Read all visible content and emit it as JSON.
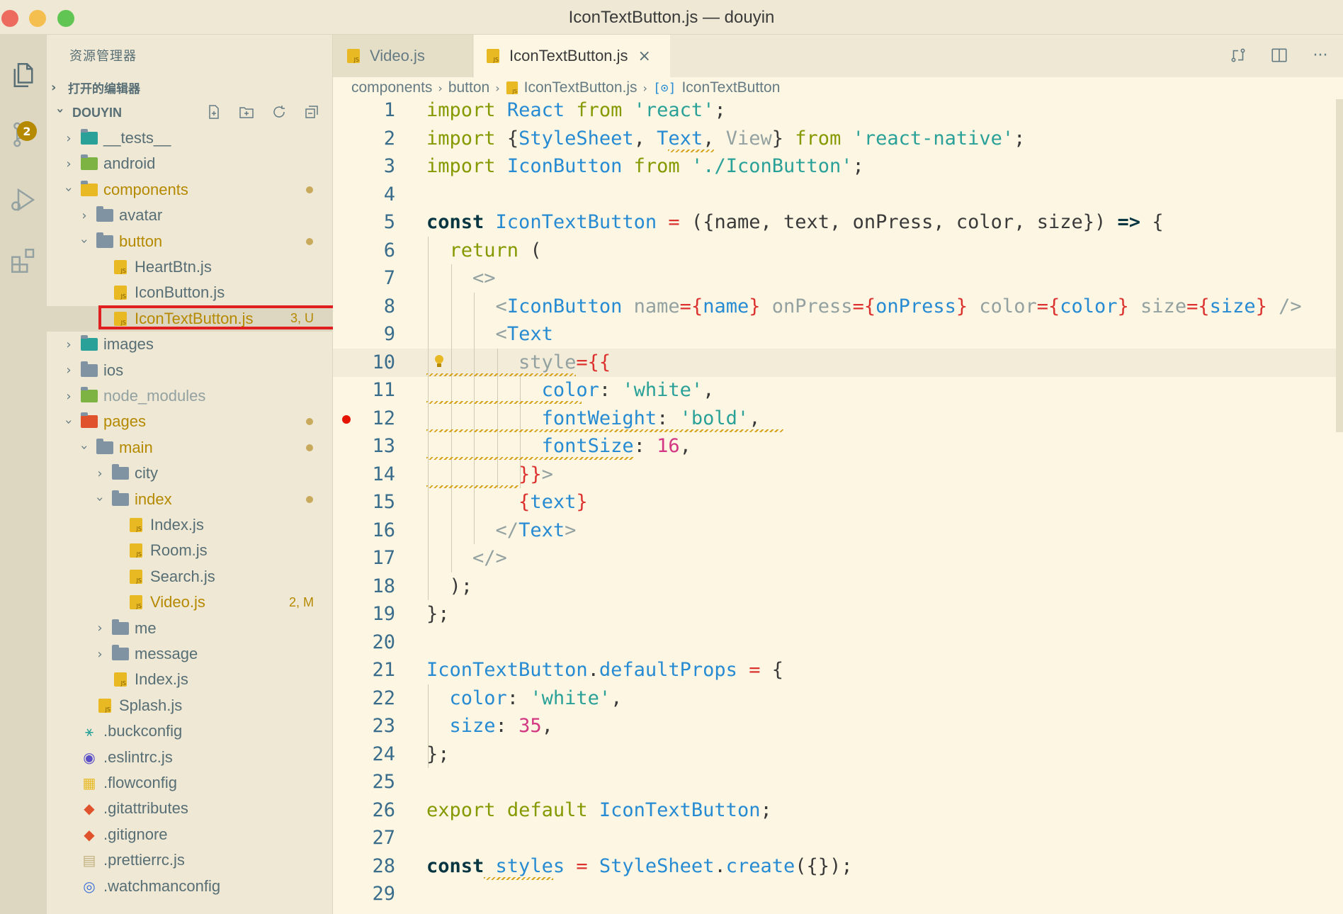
{
  "window": {
    "title": "IconTextButton.js — douyin"
  },
  "activity_bar": {
    "items": [
      {
        "icon": "explorer-icon"
      },
      {
        "icon": "source-control-icon",
        "badge": "2"
      },
      {
        "icon": "run-debug-icon"
      },
      {
        "icon": "extensions-icon"
      }
    ]
  },
  "sidebar": {
    "title": "资源管理器",
    "open_editors": "打开的编辑器",
    "project": "DOUYIN",
    "tools": [
      "new-file-icon",
      "new-folder-icon",
      "refresh-icon",
      "collapse-all-icon"
    ],
    "tree": [
      {
        "name": "__tests__",
        "type": "folder",
        "expanded": false,
        "depth": 0
      },
      {
        "name": "android",
        "type": "folder",
        "expanded": false,
        "depth": 0
      },
      {
        "name": "components",
        "type": "folder",
        "expanded": true,
        "depth": 0,
        "modified": true
      },
      {
        "name": "avatar",
        "type": "folder",
        "expanded": false,
        "depth": 1
      },
      {
        "name": "button",
        "type": "folder",
        "expanded": true,
        "depth": 1,
        "modified": true
      },
      {
        "name": "HeartBtn.js",
        "type": "js",
        "depth": 2
      },
      {
        "name": "IconButton.js",
        "type": "js",
        "depth": 2
      },
      {
        "name": "IconTextButton.js",
        "type": "js",
        "depth": 2,
        "decoration": "3, U",
        "selected": true
      },
      {
        "name": "images",
        "type": "folder",
        "expanded": false,
        "depth": 0
      },
      {
        "name": "ios",
        "type": "folder",
        "expanded": false,
        "depth": 0
      },
      {
        "name": "node_modules",
        "type": "folder",
        "expanded": false,
        "depth": 0,
        "ignored": true
      },
      {
        "name": "pages",
        "type": "folder",
        "expanded": true,
        "depth": 0,
        "modified": true
      },
      {
        "name": "main",
        "type": "folder",
        "expanded": true,
        "depth": 1,
        "modified": true
      },
      {
        "name": "city",
        "type": "folder",
        "expanded": false,
        "depth": 2
      },
      {
        "name": "index",
        "type": "folder",
        "expanded": true,
        "depth": 2,
        "modified": true
      },
      {
        "name": "Index.js",
        "type": "js",
        "depth": 3
      },
      {
        "name": "Room.js",
        "type": "js",
        "depth": 3
      },
      {
        "name": "Search.js",
        "type": "js",
        "depth": 3
      },
      {
        "name": "Video.js",
        "type": "js",
        "depth": 3,
        "decoration": "2, M"
      },
      {
        "name": "me",
        "type": "folder",
        "expanded": false,
        "depth": 2
      },
      {
        "name": "message",
        "type": "folder",
        "expanded": false,
        "depth": 2
      },
      {
        "name": "Index.js",
        "type": "js",
        "depth": 2
      },
      {
        "name": "Splash.js",
        "type": "js",
        "depth": 1
      },
      {
        "name": ".buckconfig",
        "type": "config",
        "depth": 0
      },
      {
        "name": ".eslintrc.js",
        "type": "eslint",
        "depth": 0
      },
      {
        "name": ".flowconfig",
        "type": "flow",
        "depth": 0
      },
      {
        "name": ".gitattributes",
        "type": "git",
        "depth": 0
      },
      {
        "name": ".gitignore",
        "type": "git",
        "depth": 0
      },
      {
        "name": ".prettierrc.js",
        "type": "prettier",
        "depth": 0
      },
      {
        "name": ".watchmanconfig",
        "type": "watchman",
        "depth": 0
      }
    ]
  },
  "tabs": [
    {
      "label": "Video.js",
      "active": false
    },
    {
      "label": "IconTextButton.js",
      "active": true
    }
  ],
  "editor_actions": [
    "open-changes-icon",
    "split-editor-icon",
    "more-actions-icon"
  ],
  "breadcrumb": [
    "components",
    "button",
    "IconTextButton.js",
    "IconTextButton"
  ],
  "editor": {
    "current_line": 10,
    "breakpoint_line": 12,
    "lightbulb_line": 10,
    "lines": [
      "import React from 'react';",
      "import {StyleSheet, Text, View} from 'react-native';",
      "import IconButton from './IconButton';",
      "",
      "const IconTextButton = ({name, text, onPress, color, size}) => {",
      "  return (",
      "    <>",
      "      <IconButton name={name} onPress={onPress} color={color} size={size} />",
      "      <Text",
      "        style={{",
      "          color: 'white',",
      "          fontWeight: 'bold',",
      "          fontSize: 16,",
      "        }}>",
      "        {text}",
      "      </Text>",
      "    </>",
      "  );",
      "};",
      "",
      "IconTextButton.defaultProps = {",
      "  color: 'white',",
      "  size: 35,",
      "};",
      "",
      "export default IconTextButton;",
      "",
      "const styles = StyleSheet.create({});",
      ""
    ]
  },
  "colors": {
    "keyword": "#859900",
    "string": "#2aa198",
    "number": "#d33682",
    "identifier": "#268bd2",
    "brace": "#dc322f",
    "background": "#fdf6e3",
    "sidebar": "#eee8d5",
    "git_modified": "#b58900",
    "highlight_box": "#e02020"
  }
}
